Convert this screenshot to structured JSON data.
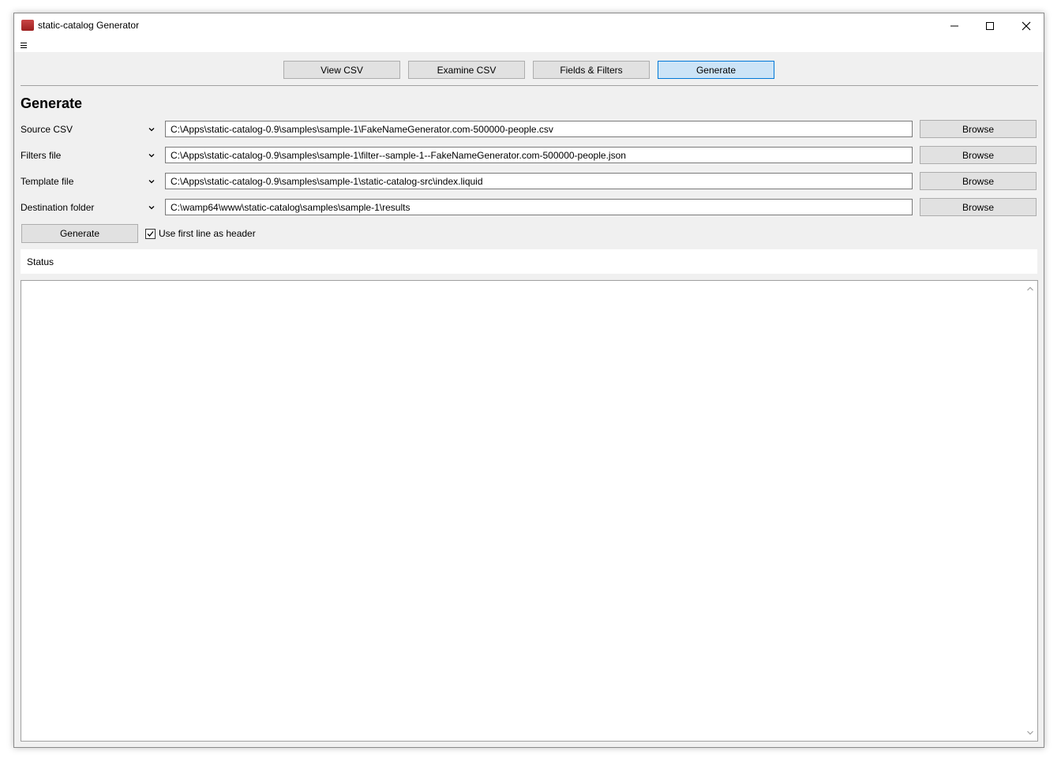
{
  "window": {
    "title": "static-catalog Generator",
    "app_icon": "app-icon",
    "controls": [
      "minimize-icon",
      "maximize-icon",
      "close-icon"
    ]
  },
  "menubar": {
    "icon": "hamburger-menu-icon"
  },
  "tabs": [
    {
      "label": "View CSV",
      "active": false
    },
    {
      "label": "Examine CSV",
      "active": false
    },
    {
      "label": "Fields & Filters",
      "active": false
    },
    {
      "label": "Generate",
      "active": true
    }
  ],
  "main": {
    "title": "Generate",
    "fields": [
      {
        "label": "Source CSV",
        "value": "C:\\Apps\\static-catalog-0.9\\samples\\sample-1\\FakeNameGenerator.com-500000-people.csv",
        "button": "Browse"
      },
      {
        "label": "Filters file",
        "value": "C:\\Apps\\static-catalog-0.9\\samples\\sample-1\\filter--sample-1--FakeNameGenerator.com-500000-people.json",
        "button": "Browse"
      },
      {
        "label": "Template file",
        "value": "C:\\Apps\\static-catalog-0.9\\samples\\sample-1\\static-catalog-src\\index.liquid",
        "button": "Browse"
      },
      {
        "label": "Destination folder",
        "value": "C:\\wamp64\\www\\static-catalog\\samples\\sample-1\\results",
        "button": "Browse"
      }
    ],
    "generate_button": "Generate",
    "header_checkbox": {
      "label": "Use first line as header",
      "checked": true
    },
    "status_label": "Status",
    "log_text": ""
  },
  "colors": {
    "window_bg": "#f0f0f0",
    "button_bg": "#e1e1e1",
    "active_tab_bg": "#cce4f7",
    "active_tab_border": "#0078d7"
  }
}
